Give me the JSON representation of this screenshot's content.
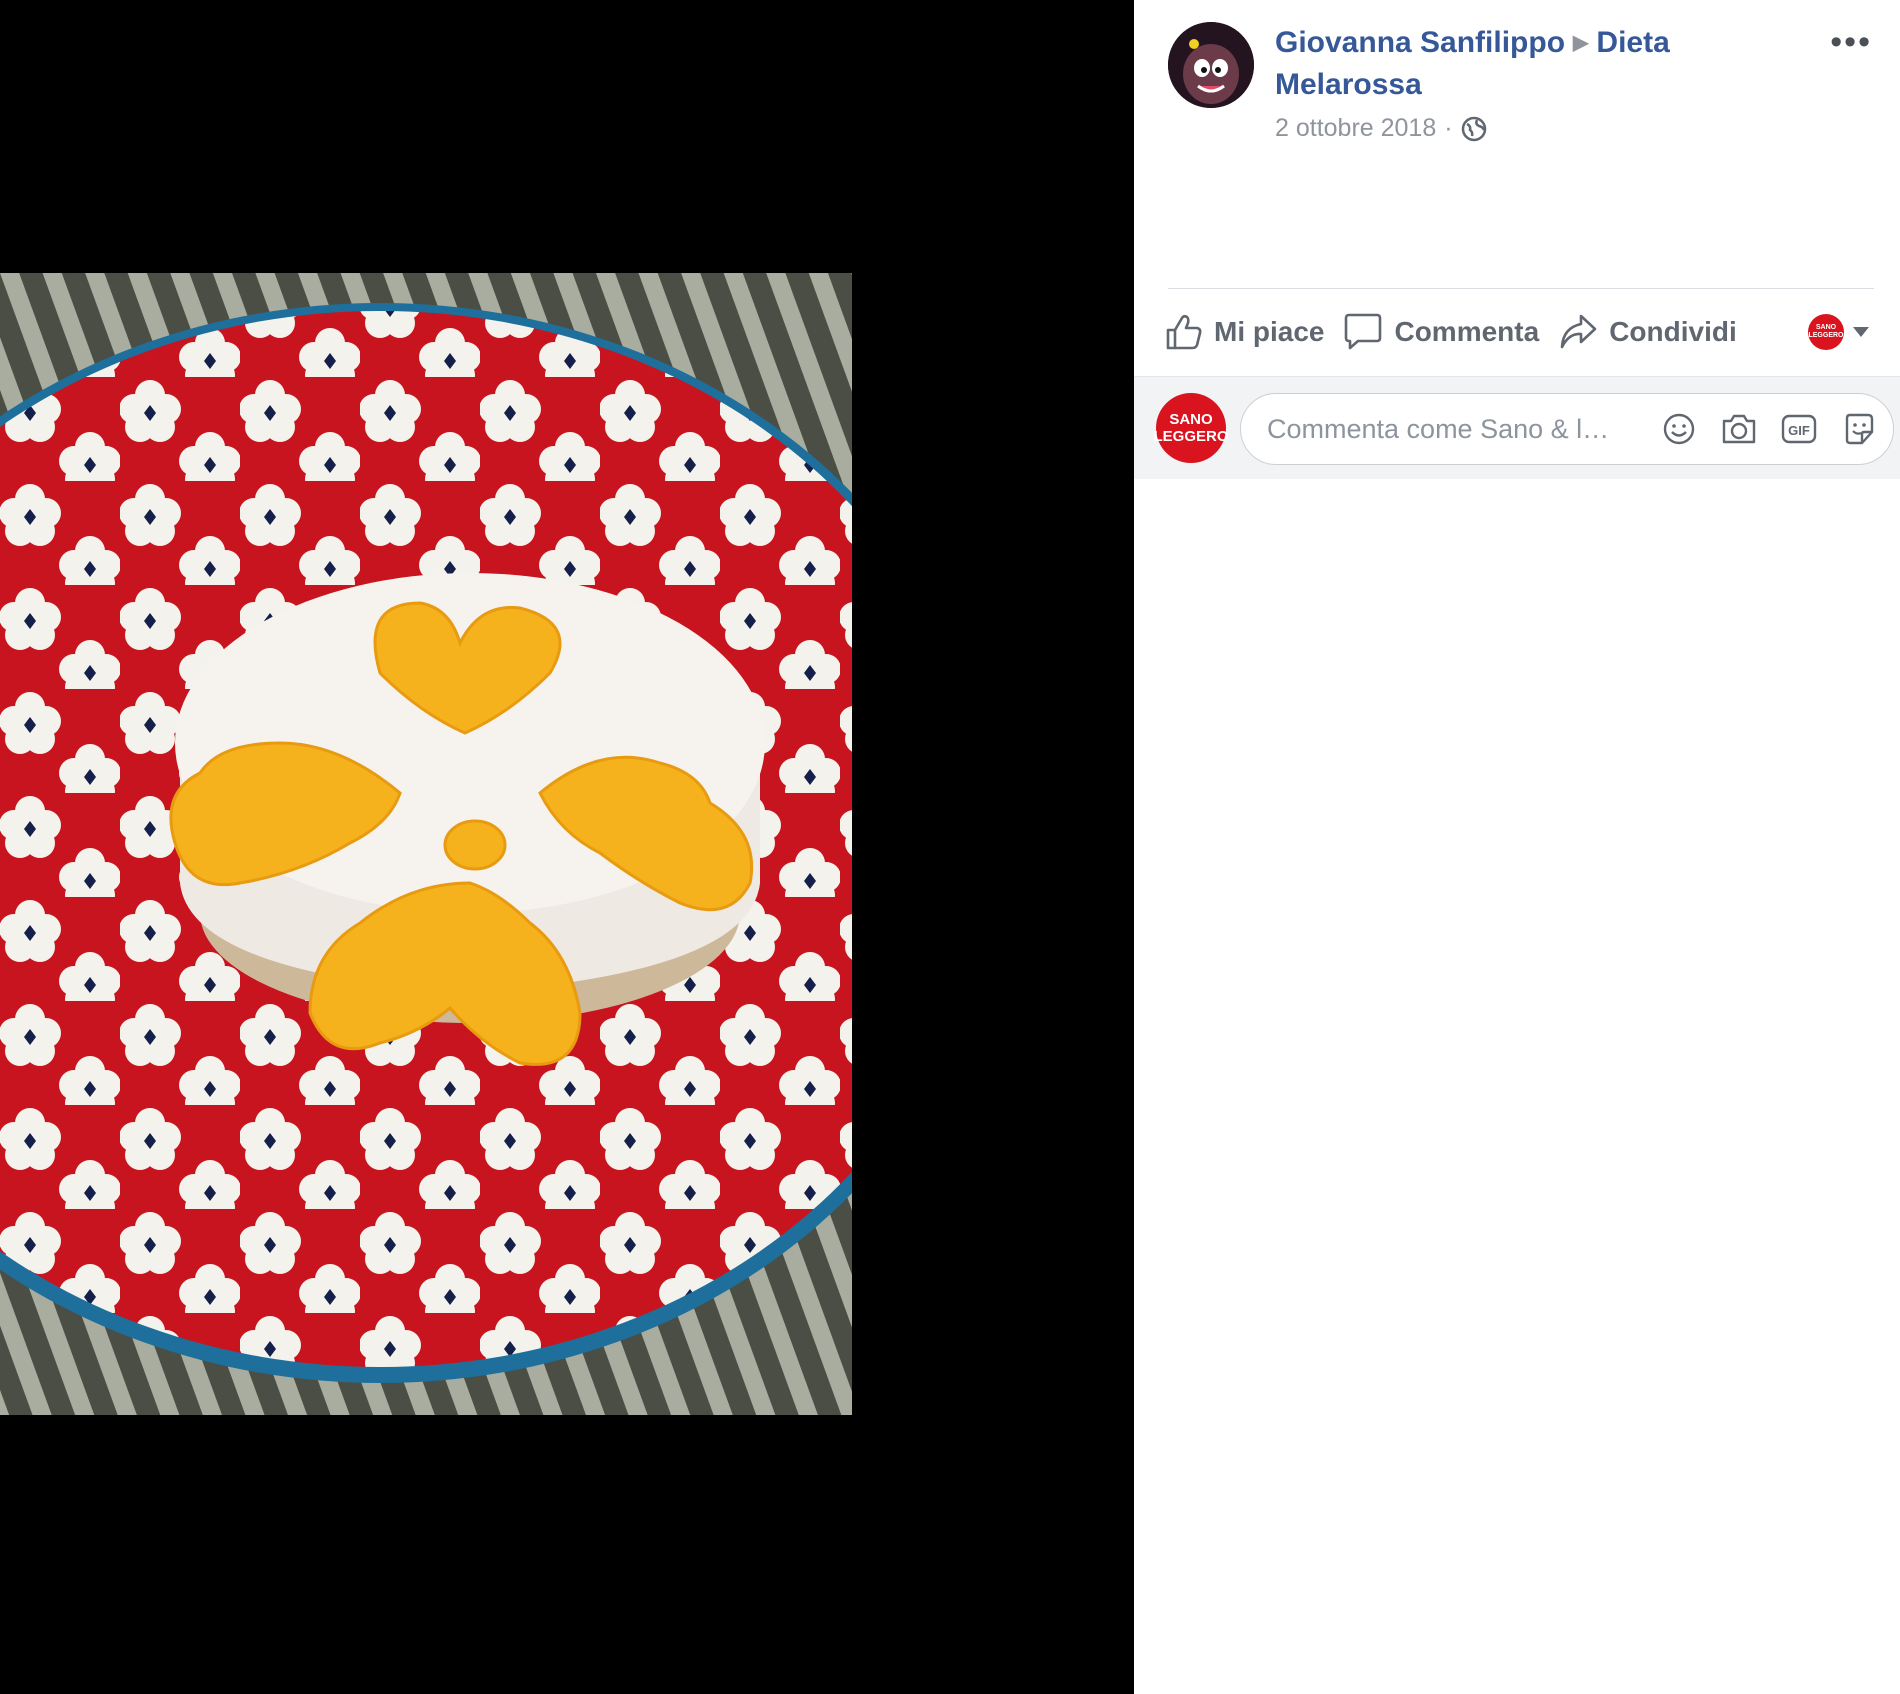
{
  "post": {
    "author": "Giovanna Sanfilippo",
    "group": "Dieta Melarossa",
    "timestamp": "2 ottobre 2018",
    "separator": "·",
    "privacy_icon": "globe-icon",
    "more_label": "•••"
  },
  "actions": {
    "like": "Mi piace",
    "comment": "Commenta",
    "share": "Condividi"
  },
  "page_selector": {
    "avatar_line1": "SANO",
    "avatar_line2": "LEGGERO"
  },
  "composer": {
    "placeholder": "Commenta come Sano & l…",
    "avatar_line1": "SANO",
    "avatar_line2": "LEGGERO",
    "gif_label": "GIF"
  },
  "colors": {
    "link": "#365899",
    "muted": "#90949c",
    "action": "#606770",
    "brand_red": "#d9141e"
  }
}
